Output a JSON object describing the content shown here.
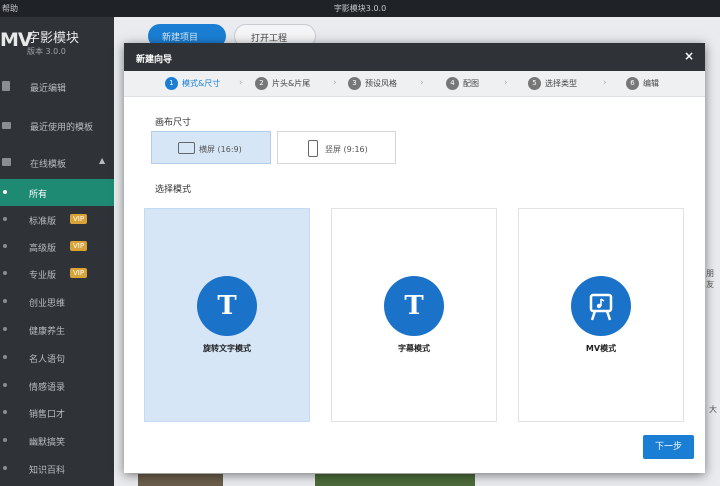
{
  "titlebar": {
    "menu": "帮助",
    "title": "字影模块3.0.0"
  },
  "brand": {
    "logo": "MV",
    "name": "字影模块",
    "version": "版本 3.0.0"
  },
  "sidebar": {
    "recent_edit": "最近编辑",
    "recent_template": "最近使用的模板",
    "online_templates": "在线模板",
    "categories": [
      {
        "label": "所有",
        "vip": ""
      },
      {
        "label": "标准版",
        "vip": "VIP"
      },
      {
        "label": "高级版",
        "vip": "VIP"
      },
      {
        "label": "专业版",
        "vip": "VIP"
      },
      {
        "label": "创业思维",
        "vip": ""
      },
      {
        "label": "健康养生",
        "vip": ""
      },
      {
        "label": "名人语句",
        "vip": ""
      },
      {
        "label": "情感语录",
        "vip": ""
      },
      {
        "label": "销售口才",
        "vip": ""
      },
      {
        "label": "幽默搞笑",
        "vip": ""
      },
      {
        "label": "知识百科",
        "vip": ""
      }
    ]
  },
  "main": {
    "new_project": "新建项目",
    "open_project": "打开工程",
    "side_hint_1": "朋友",
    "side_hint_2": "大"
  },
  "modal": {
    "title": "新建向导",
    "close": "×",
    "steps": [
      {
        "num": "1",
        "label": "模式&尺寸"
      },
      {
        "num": "2",
        "label": "片头&片尾"
      },
      {
        "num": "3",
        "label": "预设风格"
      },
      {
        "num": "4",
        "label": "配图"
      },
      {
        "num": "5",
        "label": "选择类型"
      },
      {
        "num": "6",
        "label": "编辑"
      }
    ],
    "canvas_size_label": "画布尺寸",
    "landscape": "横屏 (16:9)",
    "portrait": "竖屏 (9:16)",
    "mode_label": "选择模式",
    "modes": [
      {
        "icon": "T",
        "label": "旋转文字模式"
      },
      {
        "icon": "T",
        "label": "字幕模式"
      },
      {
        "icon": "",
        "label": "MV模式"
      }
    ],
    "next": "下一步"
  },
  "colors": {
    "accent": "#1a7fd4",
    "sidebar_active": "#1e8a73",
    "vip": "#d9a33a"
  }
}
